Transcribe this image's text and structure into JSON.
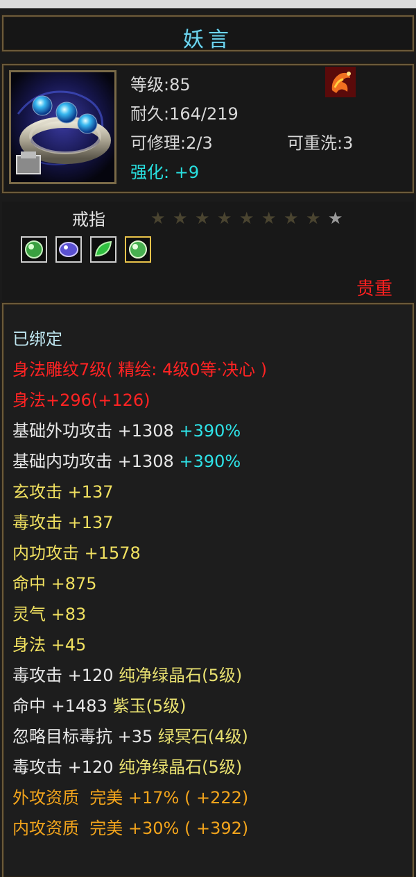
{
  "item": {
    "name": "妖言",
    "level": "等级:85",
    "durability": "耐久:164/219",
    "repairable": "可修理:2/3",
    "rewash": "可重洗:3",
    "enhance": "强化: +9",
    "type": "戒指",
    "stars": {
      "filled": 8,
      "total": 9
    },
    "rarity": "贵重",
    "gem_slots": [
      "green-gem",
      "purple-gem",
      "green-leaf-gem",
      "green-gem-gold"
    ]
  },
  "attributes": {
    "bound": "已绑定",
    "engrave": "身法雕纹7级( 精绘: 4级0等·决心 )",
    "agility_total": "身法+296(+126)",
    "base_ext_atk": "基础外功攻击 +1308",
    "base_ext_atk_pct": "+390%",
    "base_int_atk": "基础内功攻击 +1308",
    "base_int_atk_pct": "+390%",
    "xuan_atk": "玄攻击 +137",
    "poison_atk": "毒攻击 +137",
    "int_atk": "内功攻击 +1578",
    "hit": "命中 +875",
    "spirit": "灵气 +83",
    "agility": "身法 +45",
    "gem1_stat": "毒攻击 +120",
    "gem1_name": "纯净绿晶石(5级)",
    "gem2_stat": "命中 +1483",
    "gem2_name": "紫玉(5级)",
    "gem3_stat": "忽略目标毒抗 +35",
    "gem3_name": "绿冥石(4级)",
    "gem4_stat": "毒攻击 +120",
    "gem4_name": "纯净绿晶石(5级)",
    "ext_quality": "外攻资质  完美 +17% ( +222)",
    "int_quality": "内攻资质  完美 +30% ( +392)"
  },
  "colors": {
    "title": "#6fd6f0",
    "rarity": "#ff2020",
    "enhance": "#28e0e0",
    "engrave": "#ff2323",
    "bonus": "#2ee3e8",
    "quality": "#f2a41c"
  }
}
